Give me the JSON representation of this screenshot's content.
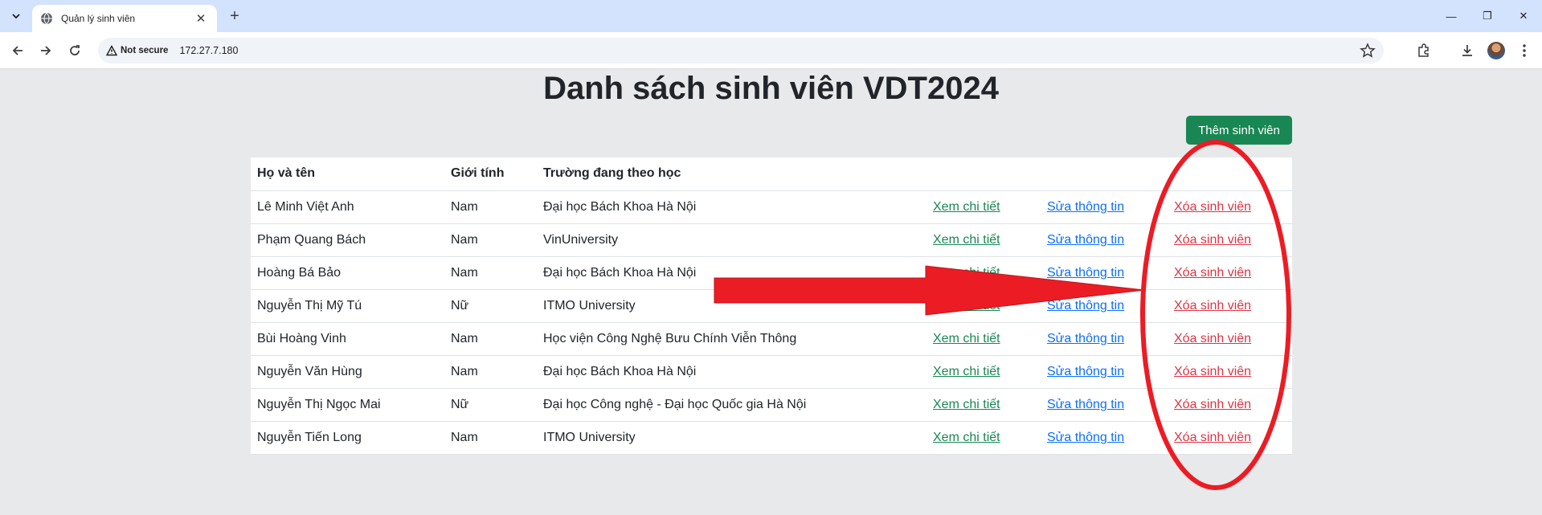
{
  "browser": {
    "tab_title": "Quản lý sinh viên",
    "security_label": "Not secure",
    "url": "172.27.7.180"
  },
  "page": {
    "title": "Danh sách sinh viên VDT2024",
    "add_button": "Thêm sinh viên"
  },
  "table": {
    "headers": [
      "Họ và tên",
      "Giới tính",
      "Trường đang theo học",
      "",
      "",
      ""
    ],
    "rows": [
      {
        "name": "Lê Minh Việt Anh",
        "gender": "Nam",
        "school": "Đại học Bách Khoa Hà Nội",
        "view": "Xem chi tiết",
        "edit": "Sửa thông tin",
        "delete": "Xóa sinh viên"
      },
      {
        "name": "Phạm Quang Bách",
        "gender": "Nam",
        "school": "VinUniversity",
        "view": "Xem chi tiết",
        "edit": "Sửa thông tin",
        "delete": "Xóa sinh viên"
      },
      {
        "name": "Hoàng Bá Bảo",
        "gender": "Nam",
        "school": "Đại học Bách Khoa Hà Nội",
        "view": "Xem chi tiết",
        "edit": "Sửa thông tin",
        "delete": "Xóa sinh viên"
      },
      {
        "name": "Nguyễn Thị Mỹ Tú",
        "gender": "Nữ",
        "school": "ITMO University",
        "view": "Xem chi tiết",
        "edit": "Sửa thông tin",
        "delete": "Xóa sinh viên"
      },
      {
        "name": "Bùi Hoàng Vinh",
        "gender": "Nam",
        "school": "Học viện Công Nghệ Bưu Chính Viễn Thông",
        "view": "Xem chi tiết",
        "edit": "Sửa thông tin",
        "delete": "Xóa sinh viên"
      },
      {
        "name": "Nguyễn Văn Hùng",
        "gender": "Nam",
        "school": "Đại học Bách Khoa Hà Nội",
        "view": "Xem chi tiết",
        "edit": "Sửa thông tin",
        "delete": "Xóa sinh viên"
      },
      {
        "name": "Nguyễn Thị Ngọc Mai",
        "gender": "Nữ",
        "school": "Đại học Công nghệ - Đại học Quốc gia Hà Nội",
        "view": "Xem chi tiết",
        "edit": "Sửa thông tin",
        "delete": "Xóa sinh viên"
      },
      {
        "name": "Nguyễn Tiến Long",
        "gender": "Nam",
        "school": "ITMO University",
        "view": "Xem chi tiết",
        "edit": "Sửa thông tin",
        "delete": "Xóa sinh viên"
      }
    ]
  },
  "annotation": {
    "color": "#ec1c24",
    "shapes": [
      "red-arrow-icon",
      "red-ellipse-highlight"
    ]
  },
  "colors": {
    "view_link": "#198754",
    "edit_link": "#0d6efd",
    "delete_link": "#dc3545",
    "add_button": "#198754"
  }
}
